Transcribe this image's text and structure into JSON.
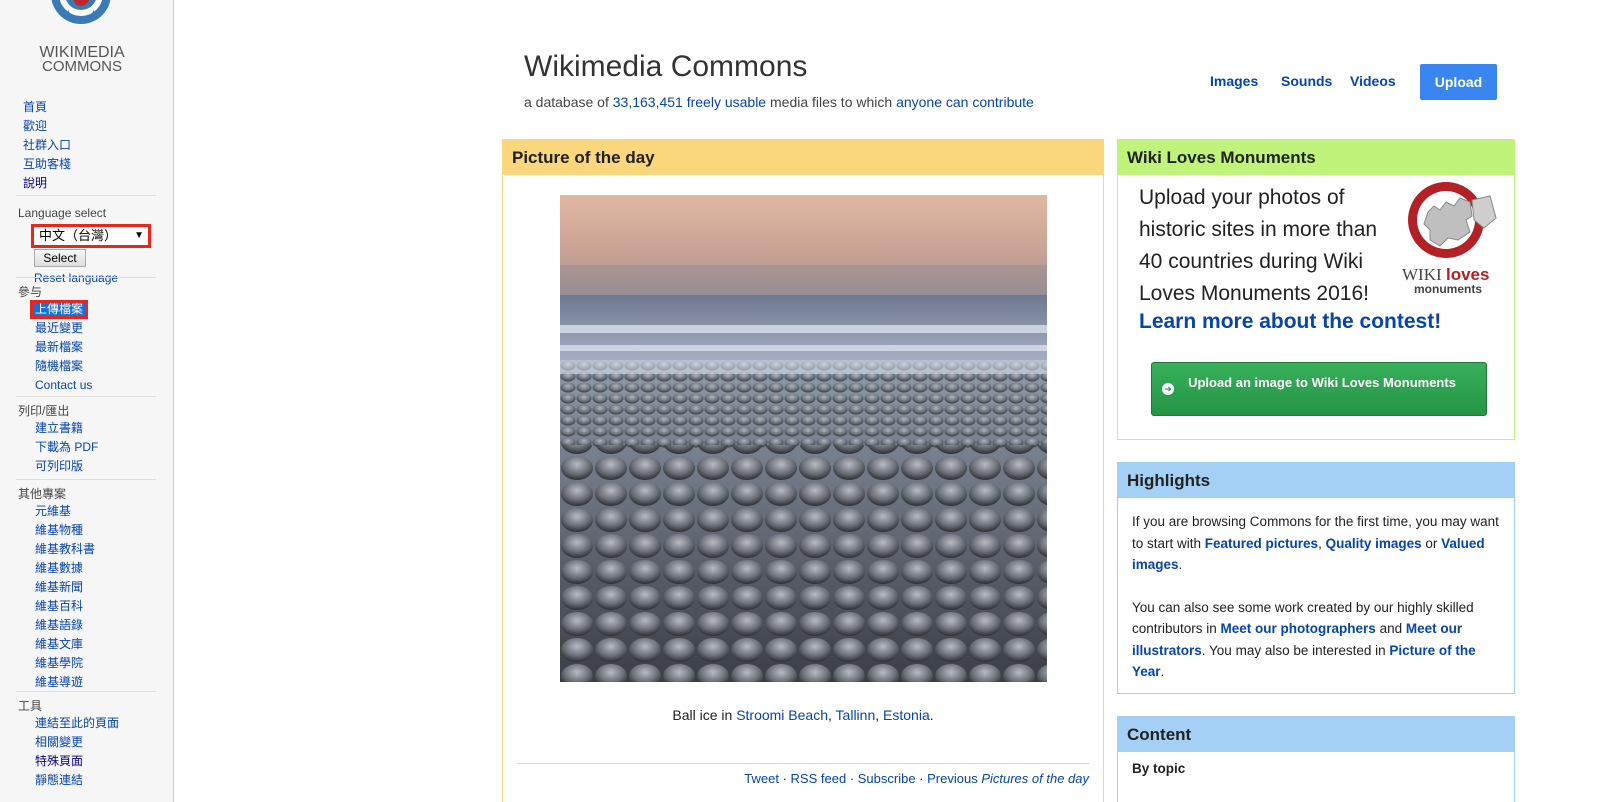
{
  "sidebar": {
    "logo_text": [
      "WIKIMEDIA",
      "COMMONS"
    ],
    "nav": [
      "首頁",
      "歡迎",
      "社群入口",
      "互助客棧",
      "說明"
    ],
    "language": {
      "heading": "Language select",
      "selected": "中文（台灣）",
      "select_button": "Select",
      "reset": "Reset language"
    },
    "participate": {
      "heading": "參与",
      "items": [
        "上傳檔案",
        "最近變更",
        "最新檔案",
        "隨機檔案",
        "Contact us"
      ]
    },
    "print": {
      "heading": "列印/匯出",
      "items": [
        "建立書籍",
        "下載為 PDF",
        "可列印版"
      ]
    },
    "projects": {
      "heading": "其他專案",
      "items": [
        "元維基",
        "維基物種",
        "維基教科書",
        "維基數據",
        "維基新聞",
        "維基百科",
        "維基語錄",
        "維基文庫",
        "維基學院",
        "維基導遊"
      ]
    },
    "tools": {
      "heading": "工具",
      "items": [
        "連結至此的頁面",
        "相關變更",
        "特殊頁面",
        "靜態連結"
      ]
    }
  },
  "header": {
    "title": "Wikimedia Commons",
    "subtitle_prefix": "a database of ",
    "file_count": "33,163,451",
    "freely_usable": "freely usable",
    "subtitle_mid": " media files to which ",
    "anyone_contribute": "anyone can contribute",
    "nav": [
      "Images",
      "Sounds",
      "Videos"
    ],
    "upload": "Upload"
  },
  "potd": {
    "heading": "Picture of the day",
    "caption_prefix": "Ball ice in ",
    "loc1": "Stroomi Beach",
    "loc2": "Tallinn",
    "loc3": "Estonia",
    "footer": {
      "tweet": "Tweet",
      "rss": "RSS feed",
      "subscribe": "Subscribe",
      "previous": "Previous ",
      "previous_em": "Pictures of the day"
    }
  },
  "wlm": {
    "heading": "Wiki Loves Monuments",
    "text": "Upload your photos of historic sites in more than 40 countries during Wiki Loves Monuments 2016!",
    "learn_more": "Learn more about the contest!",
    "logo_wiki": "WIKI",
    "logo_loves": "loves",
    "logo_monuments": "monuments",
    "button": "Upload an image to Wiki Loves Monuments"
  },
  "highlights": {
    "heading": "Highlights",
    "p1_a": "If you are browsing Commons for the first time, you may want to start with ",
    "featured": "Featured pictures",
    "quality": "Quality images",
    "p1_or": " or ",
    "valued": "Valued images",
    "p2_a": "You can also see some work created by our highly skilled contributors in ",
    "photographers": "Meet our photographers",
    "p2_and": " and ",
    "illustrators": "Meet our illustrators",
    "p2_b": ". You may also be interested in ",
    "poty": "Picture of the Year"
  },
  "content_box": {
    "heading": "Content",
    "by_topic": "By topic"
  },
  "colors": {
    "potd": "#fad67d",
    "wlm": "#bff37a",
    "highlights": "#a5d0f5",
    "upload_button": "#3a86f0",
    "link": "#0645ad"
  }
}
